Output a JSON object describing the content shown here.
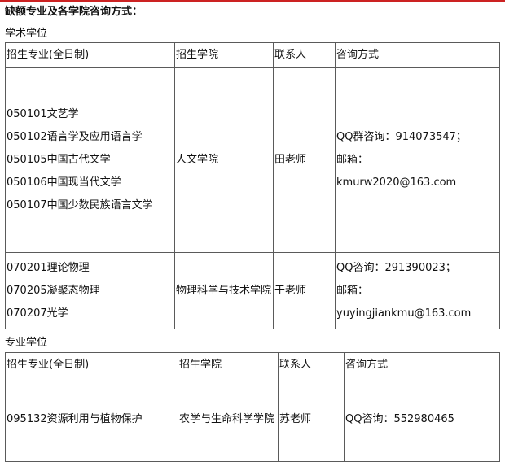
{
  "accent_color": "#cc2222",
  "heading": "缺额专业及各学院咨询方式：",
  "academic": {
    "label": "学术学位",
    "headers": [
      "招生专业(全日制)",
      "招生学院",
      "联系人",
      "咨询方式"
    ],
    "rows": [
      {
        "majors": [
          "050101文艺学",
          "050102语言学及应用语言学",
          "050105中国古代文学",
          "050106中国现当代文学",
          "050107中国少数民族语言文学"
        ],
        "college": "人文学院",
        "contact": "田老师",
        "consult": [
          "QQ群咨询：914073547；",
          "邮箱：",
          "kmurw2020@163.com"
        ]
      },
      {
        "majors": [
          "070201理论物理",
          "070205凝聚态物理",
          "070207光学"
        ],
        "college": "物理科学与技术学院",
        "contact": "于老师",
        "consult": [
          "QQ咨询：291390023；",
          "邮箱：",
          "yuyingjiankmu@163.com"
        ]
      }
    ]
  },
  "professional": {
    "label": "专业学位",
    "headers": [
      "招生专业(全日制)",
      "招生学院",
      "联系人",
      "咨询方式"
    ],
    "rows": [
      {
        "majors": [
          "095132资源利用与植物保护"
        ],
        "college": "农学与生命科学学院",
        "contact": "苏老师",
        "consult": [
          "QQ咨询：552980465"
        ]
      }
    ]
  }
}
